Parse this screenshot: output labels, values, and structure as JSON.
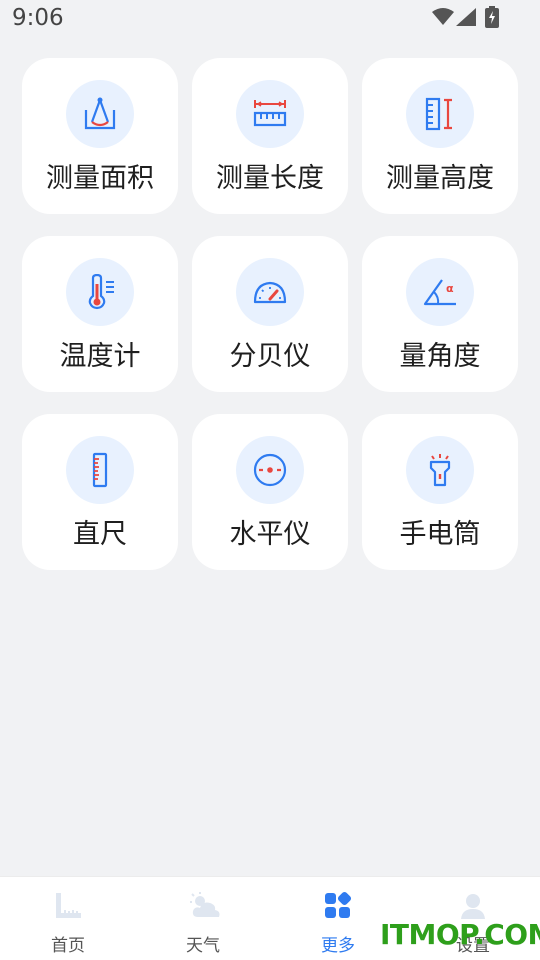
{
  "status_bar": {
    "time": "9:06",
    "icons": [
      "wifi-icon",
      "signal-icon",
      "battery-charging-icon"
    ]
  },
  "tools": [
    {
      "label": "测量面积",
      "icon": "area-measure-icon"
    },
    {
      "label": "测量长度",
      "icon": "ruler-length-icon"
    },
    {
      "label": "测量高度",
      "icon": "height-ruler-icon"
    },
    {
      "label": "温度计",
      "icon": "thermometer-icon"
    },
    {
      "label": "分贝仪",
      "icon": "decibel-gauge-icon"
    },
    {
      "label": "量角度",
      "icon": "protractor-angle-icon"
    },
    {
      "label": "直尺",
      "icon": "straight-ruler-icon"
    },
    {
      "label": "水平仪",
      "icon": "level-icon"
    },
    {
      "label": "手电筒",
      "icon": "flashlight-icon"
    }
  ],
  "bottom_nav": [
    {
      "label": "首页",
      "icon": "home-ruler-icon",
      "active": false
    },
    {
      "label": "天气",
      "icon": "weather-icon",
      "active": false
    },
    {
      "label": "更多",
      "icon": "more-apps-icon",
      "active": true
    },
    {
      "label": "设置",
      "icon": "user-settings-icon",
      "active": false
    }
  ],
  "watermark": "ITMOP.COM",
  "colors": {
    "accent": "#2f7bf0",
    "background": "#f1f2f4",
    "icon_circle": "#e8f1fe",
    "icon_red": "#e9473f"
  }
}
